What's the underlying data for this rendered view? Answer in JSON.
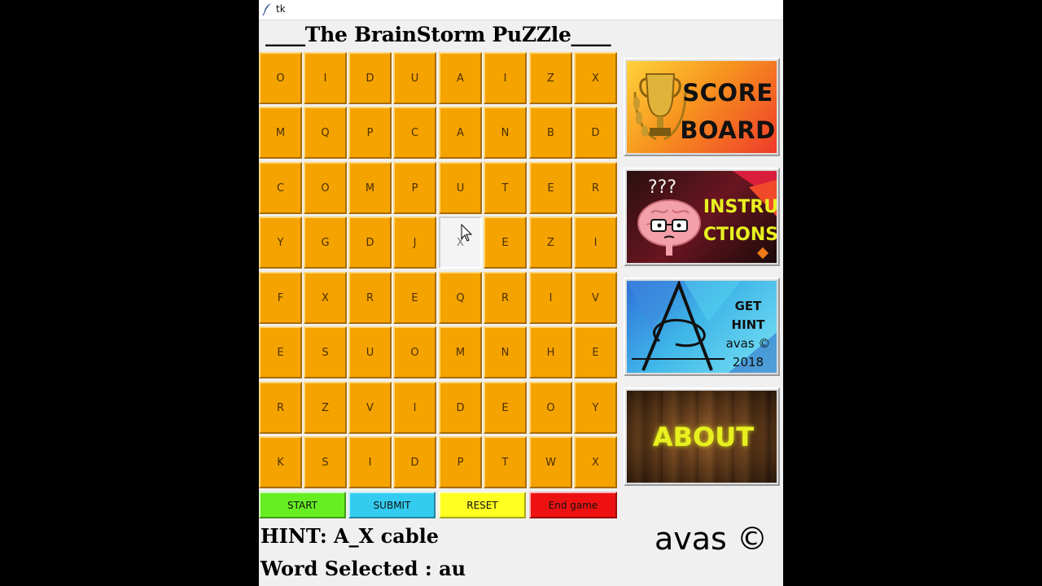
{
  "window": {
    "title": "tk"
  },
  "heading": "____The BrainStorm PuZZle____",
  "grid": {
    "rows": [
      [
        "O",
        "I",
        "D",
        "U",
        "A",
        "I",
        "Z",
        "X"
      ],
      [
        "M",
        "Q",
        "P",
        "C",
        "A",
        "N",
        "B",
        "D"
      ],
      [
        "C",
        "O",
        "M",
        "P",
        "U",
        "T",
        "E",
        "R"
      ],
      [
        "Y",
        "G",
        "D",
        "J",
        "X",
        "E",
        "Z",
        "I"
      ],
      [
        "F",
        "X",
        "R",
        "E",
        "Q",
        "R",
        "I",
        "V"
      ],
      [
        "E",
        "S",
        "U",
        "O",
        "M",
        "N",
        "H",
        "E"
      ],
      [
        "R",
        "Z",
        "V",
        "I",
        "D",
        "E",
        "O",
        "Y"
      ],
      [
        "K",
        "S",
        "I",
        "D",
        "P",
        "T",
        "W",
        "X"
      ]
    ],
    "selected": {
      "row": 3,
      "col": 4
    }
  },
  "side_buttons": {
    "score": {
      "line1": "SCORE",
      "line2": "BOARD"
    },
    "instructions": {
      "marks": "???",
      "line1": "INSTRU",
      "line2": "CTIONS"
    },
    "hint": {
      "line1": "GET",
      "line2": "HINT",
      "line3": "avas ©",
      "line4": "2018"
    },
    "about": {
      "label": "ABOUT"
    }
  },
  "controls": {
    "start": "START",
    "submit": "SUBMIT",
    "reset": "RESET",
    "end": "End game"
  },
  "colors": {
    "tile": "#f5a300",
    "start": "#66ee22",
    "submit": "#33ccf0",
    "reset": "#ffff22",
    "end": "#ee1111"
  },
  "status": {
    "hint": "HINT: A_X cable",
    "word_selected": "Word Selected : au"
  },
  "footer": {
    "copyright": "avas ©"
  }
}
